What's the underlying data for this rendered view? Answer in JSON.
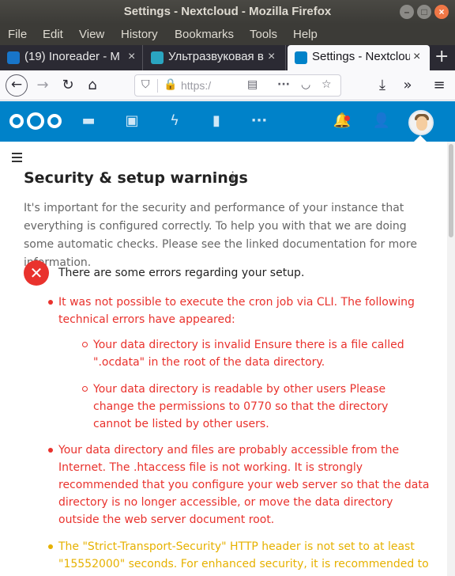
{
  "window": {
    "title": "Settings - Nextcloud - Mozilla Firefox"
  },
  "menubar": {
    "file": "File",
    "edit": "Edit",
    "view": "View",
    "history": "History",
    "bookmarks": "Bookmarks",
    "tools": "Tools",
    "help": "Help"
  },
  "tabs": [
    {
      "label": "(19) Inoreader - M"
    },
    {
      "label": "Ультразвуковая в"
    },
    {
      "label": "Settings - Nextclou"
    }
  ],
  "navbar": {
    "url": "https:/"
  },
  "colors": {
    "brand": "#0082c9",
    "error": "#e9322d",
    "warning": "#e6b100"
  },
  "content": {
    "title": "Security & setup warnings",
    "info_glyph": "i",
    "description": "It's important for the security and performance of your instance that everything is configured correctly. To help you with that we are doing some automatic checks. Please see the linked documentation for more information.",
    "error_heading": "There are some errors regarding your setup.",
    "errors": [
      {
        "text": "It was not possible to execute the cron job via CLI. The following technical errors have appeared:",
        "sub": [
          "Your data directory is invalid Ensure there is a file called \".ocdata\" in the root of the data directory.",
          "Your data directory is readable by other users Please change the permissions to 0770 so that the directory cannot be listed by other users."
        ]
      },
      {
        "text": "Your data directory and files are probably accessible from the Internet. The .htaccess file is not working. It is strongly recommended that you configure your web server so that the data directory is no longer accessible, or move the data directory outside the web server document root."
      }
    ],
    "warning": "The \"Strict-Transport-Security\" HTTP header is not set to at least \"15552000\" seconds. For enhanced security, it is recommended to enable"
  }
}
